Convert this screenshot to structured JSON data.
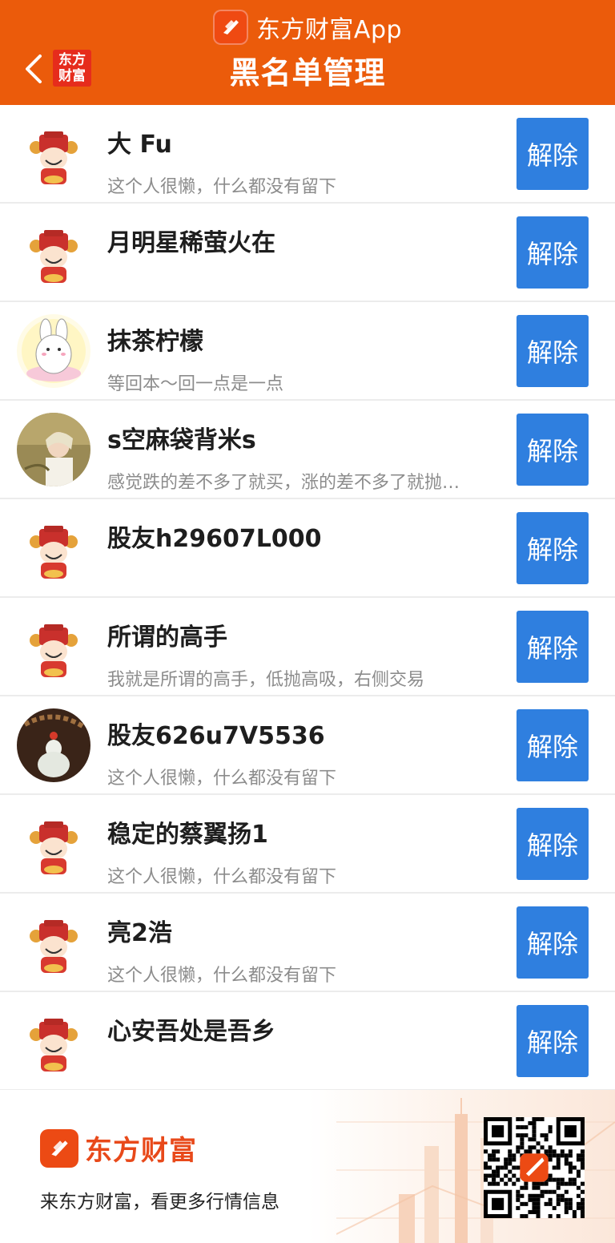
{
  "header": {
    "app_name": "东方财富App",
    "badge_text": "东方\n财富",
    "title": "黑名单管理",
    "bg_color": "#eb5b0b"
  },
  "list": {
    "button_color": "#2f7fdf",
    "items": [
      {
        "name": "大 Fu",
        "signature": "这个人很懒，什么都没有留下",
        "avatar": "fortune-god",
        "action": "解除"
      },
      {
        "name": "月明星稀萤火在",
        "signature": "",
        "avatar": "fortune-god",
        "action": "解除"
      },
      {
        "name": "抹茶柠檬",
        "signature": "等回本～回一点是一点",
        "avatar": "bunny",
        "action": "解除"
      },
      {
        "name": "s空麻袋背米s",
        "signature": "感觉跌的差不多了就买，涨的差不多了就抛…",
        "avatar": "person-photo",
        "action": "解除"
      },
      {
        "name": "股友h29607L000",
        "signature": "",
        "avatar": "fortune-god",
        "action": "解除"
      },
      {
        "name": "所谓的高手",
        "signature": "我就是所谓的高手，低抛高吸，右侧交易",
        "avatar": "fortune-god",
        "action": "解除"
      },
      {
        "name": "股友626u7V5536",
        "signature": "这个人很懒，什么都没有留下",
        "avatar": "jade-buddha",
        "action": "解除"
      },
      {
        "name": "稳定的蔡翼扬1",
        "signature": "这个人很懒，什么都没有留下",
        "avatar": "fortune-god",
        "action": "解除"
      },
      {
        "name": "亮2浩",
        "signature": "这个人很懒，什么都没有留下",
        "avatar": "fortune-god",
        "action": "解除"
      },
      {
        "name": "心安吾处是吾乡",
        "signature": "",
        "avatar": "fortune-god",
        "action": "解除"
      }
    ]
  },
  "footer": {
    "brand": "东方财富",
    "slogan": "来东方财富，看更多行情信息"
  }
}
